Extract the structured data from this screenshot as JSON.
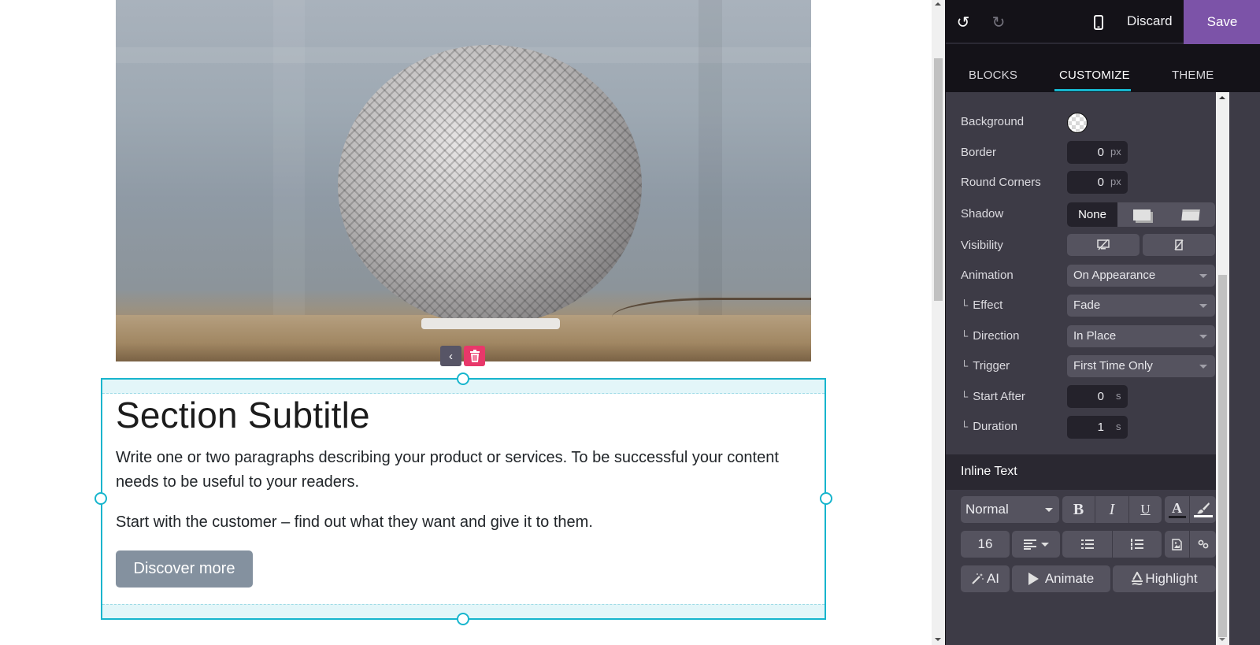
{
  "canvas": {
    "section": {
      "title": "Section Subtitle",
      "paragraph1": "Write one or two paragraphs describing your product or services. To be successful your content needs to be useful to your readers.",
      "paragraph2": "Start with the customer – find out what they want and give it to them.",
      "button_label": "Discover more"
    },
    "image_tools": {
      "back_icon": "‹",
      "delete_icon": "trash-icon"
    }
  },
  "panel": {
    "topbar": {
      "undo_icon": "↺",
      "redo_icon": "↻",
      "mobile_icon": "mobile-icon",
      "discard_label": "Discard",
      "save_label": "Save"
    },
    "tabs": [
      {
        "label": "BLOCKS",
        "active": false
      },
      {
        "label": "CUSTOMIZE",
        "active": true
      },
      {
        "label": "THEME",
        "active": false
      }
    ],
    "options": {
      "background": {
        "label": "Background",
        "value": "transparent"
      },
      "border": {
        "label": "Border",
        "value": "0",
        "unit": "px"
      },
      "round_corners": {
        "label": "Round Corners",
        "value": "0",
        "unit": "px"
      },
      "shadow": {
        "label": "Shadow",
        "options": [
          "None",
          "outset-shadow",
          "inset-shadow"
        ],
        "selected": "None"
      },
      "visibility": {
        "label": "Visibility"
      },
      "animation": {
        "label": "Animation",
        "value": "On Appearance"
      },
      "effect": {
        "label": "Effect",
        "value": "Fade"
      },
      "direction": {
        "label": "Direction",
        "value": "In Place"
      },
      "trigger": {
        "label": "Trigger",
        "value": "First Time Only"
      },
      "start_after": {
        "label": "Start After",
        "value": "0",
        "unit": "s"
      },
      "duration": {
        "label": "Duration",
        "value": "1",
        "unit": "s"
      },
      "sub_marker": "└"
    },
    "inline_text": {
      "heading": "Inline Text",
      "style_value": "Normal",
      "bold": "B",
      "italic": "I",
      "underline": "U",
      "font_color": "A",
      "font_size": "16",
      "ai_label": "AI",
      "animate_label": "Animate",
      "highlight_label": "Highlight"
    }
  }
}
